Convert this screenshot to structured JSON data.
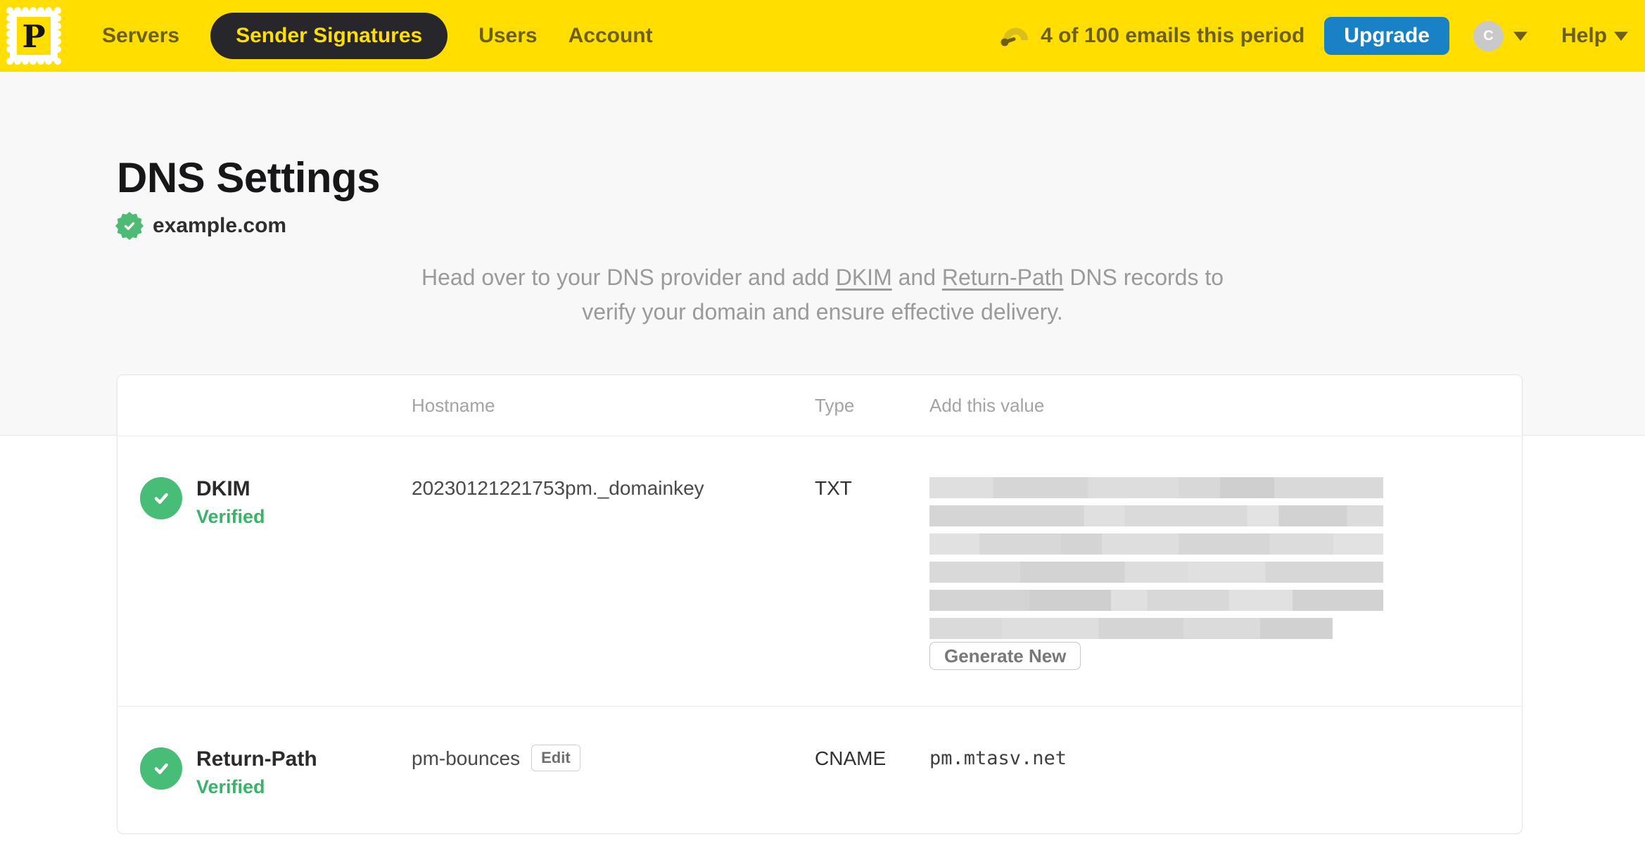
{
  "brand": {
    "yellow": "#FFDE00",
    "nav_text_color": "#6C6018",
    "active_pill_bg": "#26262B",
    "upgrade_blue": "#1981C6",
    "check_green": "#47BD77",
    "verified_text_green": "#37B468",
    "logo_letter": "P"
  },
  "nav": {
    "items": [
      {
        "label": "Servers",
        "active": false
      },
      {
        "label": "Sender Signatures",
        "active": true
      },
      {
        "label": "Users",
        "active": false
      },
      {
        "label": "Account",
        "active": false
      }
    ],
    "usage_text": "4 of 100 emails this period",
    "upgrade_label": "Upgrade",
    "avatar_initial": "C",
    "help_label": "Help"
  },
  "page": {
    "title": "DNS Settings",
    "domain": "example.com",
    "intro": {
      "line1_pre": "Head over to your DNS provider and add ",
      "link_dkim": "DKIM",
      "between": " and ",
      "link_return_path": "Return-Path",
      "line1_post": " DNS records to",
      "line2": "verify your domain and ensure effective delivery."
    }
  },
  "table": {
    "headers": {
      "hostname": "Hostname",
      "type": "Type",
      "value": "Add this value"
    },
    "rows": [
      {
        "name": "DKIM",
        "status": "Verified",
        "hostname": "20230121221753pm._domainkey",
        "type": "TXT",
        "value_redacted": true,
        "redacted_lines": 6,
        "action_label": "Generate New"
      },
      {
        "name": "Return-Path",
        "status": "Verified",
        "hostname": "pm-bounces",
        "edit_label": "Edit",
        "type": "CNAME",
        "value": "pm.mtasv.net"
      }
    ]
  }
}
